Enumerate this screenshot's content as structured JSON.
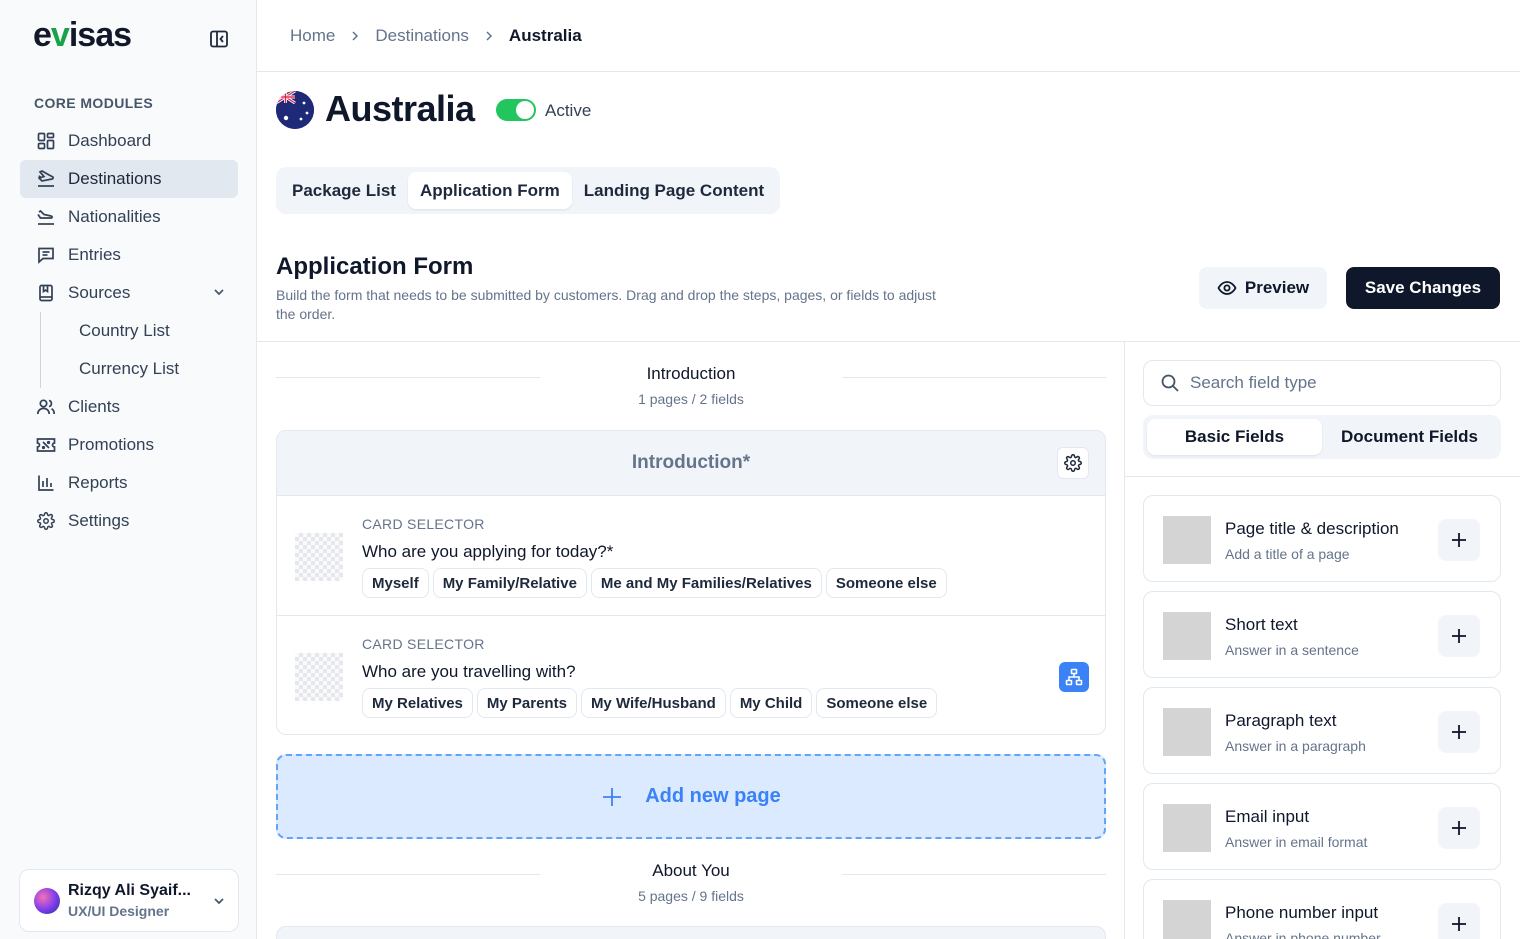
{
  "brand": {
    "logo_pre": "e",
    "logo_v": "v",
    "logo_post": "isas"
  },
  "sidebar": {
    "section_label": "CORE MODULES",
    "items": [
      {
        "label": "Dashboard",
        "icon": "grid-icon"
      },
      {
        "label": "Destinations",
        "icon": "plane-icon",
        "active": true
      },
      {
        "label": "Nationalities",
        "icon": "plane-landing-icon"
      },
      {
        "label": "Entries",
        "icon": "message-icon"
      },
      {
        "label": "Sources",
        "icon": "book-icon",
        "expanded": true
      },
      {
        "label": "Country List"
      },
      {
        "label": "Currency List"
      },
      {
        "label": "Clients",
        "icon": "users-icon"
      },
      {
        "label": "Promotions",
        "icon": "ticket-icon"
      },
      {
        "label": "Reports",
        "icon": "bar-chart-icon"
      },
      {
        "label": "Settings",
        "icon": "gear-icon"
      }
    ]
  },
  "user": {
    "name": "Rizqy Ali Syaif...",
    "role": "UX/UI Designer"
  },
  "breadcrumb": [
    "Home",
    "Destinations",
    "Australia"
  ],
  "destination": {
    "name": "Australia",
    "status": "Active",
    "active": true
  },
  "tabs": [
    "Package List",
    "Application Form",
    "Landing Page Content"
  ],
  "selected_tab": "Application Form",
  "form": {
    "title": "Application Form",
    "description": "Build the form that needs to be submitted by customers. Drag and drop the steps, pages, or fields to adjust the order.",
    "preview_label": "Preview",
    "save_label": "Save Changes"
  },
  "steps": [
    {
      "name": "Introduction",
      "meta": "1 pages / 2 fields",
      "page_title": "Introduction*",
      "fields": [
        {
          "type": "CARD SELECTOR",
          "question": "Who are you applying for today?*",
          "options": [
            "Myself",
            "My Family/Relative",
            "Me and My Families/Relatives",
            "Someone else"
          ]
        },
        {
          "type": "CARD SELECTOR",
          "question": "Who are you travelling with?",
          "options": [
            "My Relatives",
            "My Parents",
            "My Wife/Husband",
            "My Child",
            "Someone else"
          ]
        }
      ]
    },
    {
      "name": "About You",
      "meta": "5 pages / 9 fields"
    }
  ],
  "add_page_label": "Add new page",
  "field_panel": {
    "search_placeholder": "Search field type",
    "tabs": [
      "Basic Fields",
      "Document Fields"
    ],
    "types": [
      {
        "name": "Page title & description",
        "desc": "Add a title of a page"
      },
      {
        "name": "Short text",
        "desc": "Answer in a sentence"
      },
      {
        "name": "Paragraph text",
        "desc": "Answer in a paragraph"
      },
      {
        "name": "Email input",
        "desc": "Answer in email format"
      },
      {
        "name": "Phone number input",
        "desc": "Answer in phone number"
      }
    ]
  },
  "colors": {
    "accent": "#22c55e",
    "primary": "#0f172a",
    "link_blue": "#3b82f6"
  }
}
